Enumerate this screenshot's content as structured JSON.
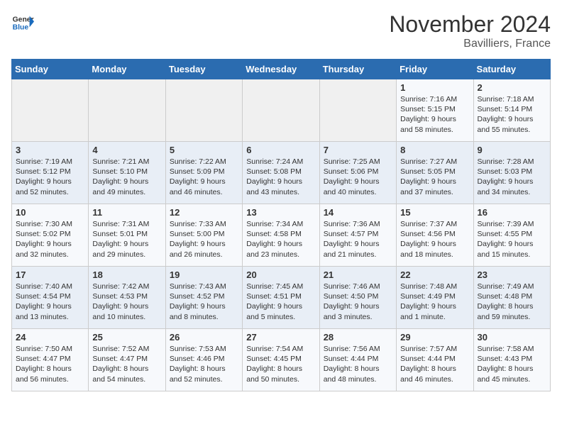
{
  "logo": {
    "line1": "General",
    "line2": "Blue"
  },
  "title": "November 2024",
  "location": "Bavilliers, France",
  "days_of_week": [
    "Sunday",
    "Monday",
    "Tuesday",
    "Wednesday",
    "Thursday",
    "Friday",
    "Saturday"
  ],
  "weeks": [
    [
      {
        "day": "",
        "info": ""
      },
      {
        "day": "",
        "info": ""
      },
      {
        "day": "",
        "info": ""
      },
      {
        "day": "",
        "info": ""
      },
      {
        "day": "",
        "info": ""
      },
      {
        "day": "1",
        "info": "Sunrise: 7:16 AM\nSunset: 5:15 PM\nDaylight: 9 hours and 58 minutes."
      },
      {
        "day": "2",
        "info": "Sunrise: 7:18 AM\nSunset: 5:14 PM\nDaylight: 9 hours and 55 minutes."
      }
    ],
    [
      {
        "day": "3",
        "info": "Sunrise: 7:19 AM\nSunset: 5:12 PM\nDaylight: 9 hours and 52 minutes."
      },
      {
        "day": "4",
        "info": "Sunrise: 7:21 AM\nSunset: 5:10 PM\nDaylight: 9 hours and 49 minutes."
      },
      {
        "day": "5",
        "info": "Sunrise: 7:22 AM\nSunset: 5:09 PM\nDaylight: 9 hours and 46 minutes."
      },
      {
        "day": "6",
        "info": "Sunrise: 7:24 AM\nSunset: 5:08 PM\nDaylight: 9 hours and 43 minutes."
      },
      {
        "day": "7",
        "info": "Sunrise: 7:25 AM\nSunset: 5:06 PM\nDaylight: 9 hours and 40 minutes."
      },
      {
        "day": "8",
        "info": "Sunrise: 7:27 AM\nSunset: 5:05 PM\nDaylight: 9 hours and 37 minutes."
      },
      {
        "day": "9",
        "info": "Sunrise: 7:28 AM\nSunset: 5:03 PM\nDaylight: 9 hours and 34 minutes."
      }
    ],
    [
      {
        "day": "10",
        "info": "Sunrise: 7:30 AM\nSunset: 5:02 PM\nDaylight: 9 hours and 32 minutes."
      },
      {
        "day": "11",
        "info": "Sunrise: 7:31 AM\nSunset: 5:01 PM\nDaylight: 9 hours and 29 minutes."
      },
      {
        "day": "12",
        "info": "Sunrise: 7:33 AM\nSunset: 5:00 PM\nDaylight: 9 hours and 26 minutes."
      },
      {
        "day": "13",
        "info": "Sunrise: 7:34 AM\nSunset: 4:58 PM\nDaylight: 9 hours and 23 minutes."
      },
      {
        "day": "14",
        "info": "Sunrise: 7:36 AM\nSunset: 4:57 PM\nDaylight: 9 hours and 21 minutes."
      },
      {
        "day": "15",
        "info": "Sunrise: 7:37 AM\nSunset: 4:56 PM\nDaylight: 9 hours and 18 minutes."
      },
      {
        "day": "16",
        "info": "Sunrise: 7:39 AM\nSunset: 4:55 PM\nDaylight: 9 hours and 15 minutes."
      }
    ],
    [
      {
        "day": "17",
        "info": "Sunrise: 7:40 AM\nSunset: 4:54 PM\nDaylight: 9 hours and 13 minutes."
      },
      {
        "day": "18",
        "info": "Sunrise: 7:42 AM\nSunset: 4:53 PM\nDaylight: 9 hours and 10 minutes."
      },
      {
        "day": "19",
        "info": "Sunrise: 7:43 AM\nSunset: 4:52 PM\nDaylight: 9 hours and 8 minutes."
      },
      {
        "day": "20",
        "info": "Sunrise: 7:45 AM\nSunset: 4:51 PM\nDaylight: 9 hours and 5 minutes."
      },
      {
        "day": "21",
        "info": "Sunrise: 7:46 AM\nSunset: 4:50 PM\nDaylight: 9 hours and 3 minutes."
      },
      {
        "day": "22",
        "info": "Sunrise: 7:48 AM\nSunset: 4:49 PM\nDaylight: 9 hours and 1 minute."
      },
      {
        "day": "23",
        "info": "Sunrise: 7:49 AM\nSunset: 4:48 PM\nDaylight: 8 hours and 59 minutes."
      }
    ],
    [
      {
        "day": "24",
        "info": "Sunrise: 7:50 AM\nSunset: 4:47 PM\nDaylight: 8 hours and 56 minutes."
      },
      {
        "day": "25",
        "info": "Sunrise: 7:52 AM\nSunset: 4:47 PM\nDaylight: 8 hours and 54 minutes."
      },
      {
        "day": "26",
        "info": "Sunrise: 7:53 AM\nSunset: 4:46 PM\nDaylight: 8 hours and 52 minutes."
      },
      {
        "day": "27",
        "info": "Sunrise: 7:54 AM\nSunset: 4:45 PM\nDaylight: 8 hours and 50 minutes."
      },
      {
        "day": "28",
        "info": "Sunrise: 7:56 AM\nSunset: 4:44 PM\nDaylight: 8 hours and 48 minutes."
      },
      {
        "day": "29",
        "info": "Sunrise: 7:57 AM\nSunset: 4:44 PM\nDaylight: 8 hours and 46 minutes."
      },
      {
        "day": "30",
        "info": "Sunrise: 7:58 AM\nSunset: 4:43 PM\nDaylight: 8 hours and 45 minutes."
      }
    ]
  ]
}
